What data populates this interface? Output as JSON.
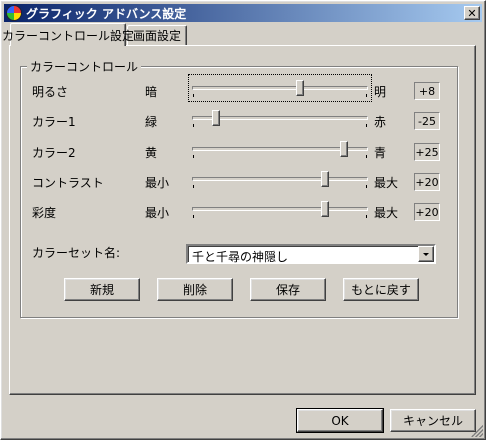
{
  "window": {
    "title": "グラフィック アドバンス設定",
    "close_label": "✕"
  },
  "tabs": [
    {
      "label": "カラーコントロール設定",
      "active": true
    },
    {
      "label": "画面設定",
      "active": false
    }
  ],
  "group": {
    "title": "カラーコントロール",
    "rows": [
      {
        "name": "明るさ",
        "min_label": "暗",
        "max_label": "明",
        "value": "+8",
        "level": 0.62
      },
      {
        "name": "カラー1",
        "min_label": "緑",
        "max_label": "赤",
        "value": "-25",
        "level": 0.12
      },
      {
        "name": "カラー2",
        "min_label": "黄",
        "max_label": "青",
        "value": "+25",
        "level": 0.88
      },
      {
        "name": "コントラスト",
        "min_label": "最小",
        "max_label": "最大",
        "value": "+20",
        "level": 0.77
      },
      {
        "name": "彩度",
        "min_label": "最小",
        "max_label": "最大",
        "value": "+20",
        "level": 0.77
      }
    ],
    "color_set_label": "カラーセット名:",
    "color_set_value": "千と千尋の神隠し",
    "buttons": [
      "新規",
      "削除",
      "保存",
      "もとに戻す"
    ]
  },
  "footer": {
    "ok_label": "OK",
    "cancel_label": "キャンセル"
  }
}
